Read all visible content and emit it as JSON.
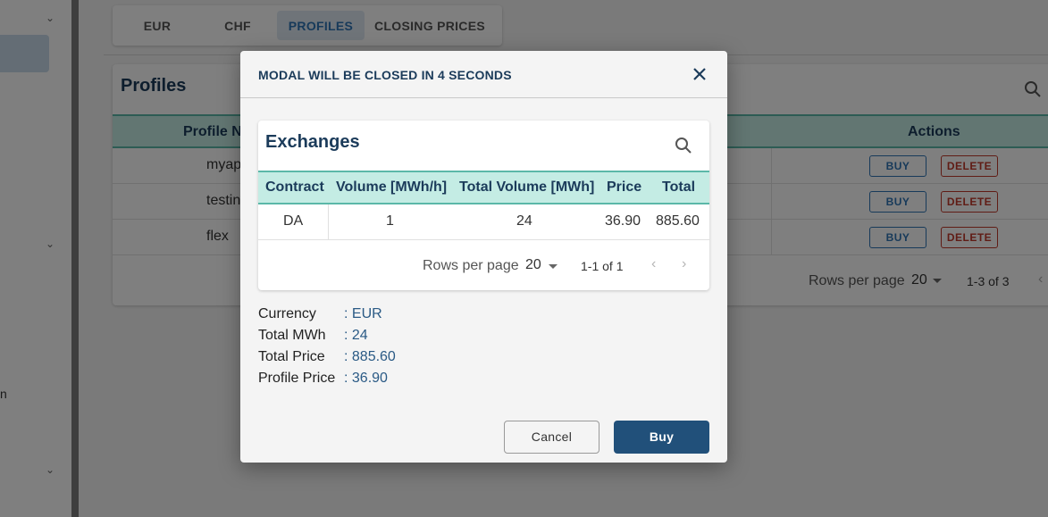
{
  "tabs": [
    {
      "label": "EUR",
      "active": false
    },
    {
      "label": "CHF",
      "active": false
    },
    {
      "label": "PROFILES",
      "active": true
    },
    {
      "label": "CLOSING PRICES",
      "active": false
    }
  ],
  "profiles": {
    "title": "Profiles",
    "columns": {
      "name": "Profile N",
      "actions": "Actions"
    },
    "rows": [
      {
        "name": "myap",
        "buy_label": "BUY",
        "delete_label": "DELETE"
      },
      {
        "name": "testin",
        "buy_label": "BUY",
        "delete_label": "DELETE"
      },
      {
        "name": "flex",
        "buy_label": "BUY",
        "delete_label": "DELETE"
      }
    ],
    "footer": {
      "rows_per_page_label": "Rows per page",
      "rows_per_page": "20",
      "range": "1-3 of 3"
    }
  },
  "sidebar": {
    "partial_glyph": "n"
  },
  "modal": {
    "title": "MODAL WILL BE CLOSED IN 4 SECONDS",
    "exchanges": {
      "title": "Exchanges",
      "columns": [
        "Contract",
        "Volume [MWh/h]",
        "Total Volume [MWh]",
        "Price",
        "Total"
      ],
      "rows": [
        {
          "contract": "DA",
          "volume": "1",
          "total_volume": "24",
          "price": "36.90",
          "total": "885.60"
        }
      ],
      "footer": {
        "rows_per_page_label": "Rows per page",
        "rows_per_page": "20",
        "range": "1-1 of 1"
      }
    },
    "summary": [
      {
        "label": "Currency",
        "value": ": EUR"
      },
      {
        "label": "Total MWh",
        "value": ": 24"
      },
      {
        "label": "Total Price",
        "value": ": 885.60"
      },
      {
        "label": "Profile Price",
        "value": ": 36.90"
      }
    ],
    "cancel_label": "Cancel",
    "buy_label": "Buy"
  },
  "colors": {
    "accent": "#2f74b5",
    "header_teal": "#c4ece4",
    "danger": "#c0392b",
    "primary_button": "#21507a",
    "title_navy": "#1b3b5a"
  }
}
